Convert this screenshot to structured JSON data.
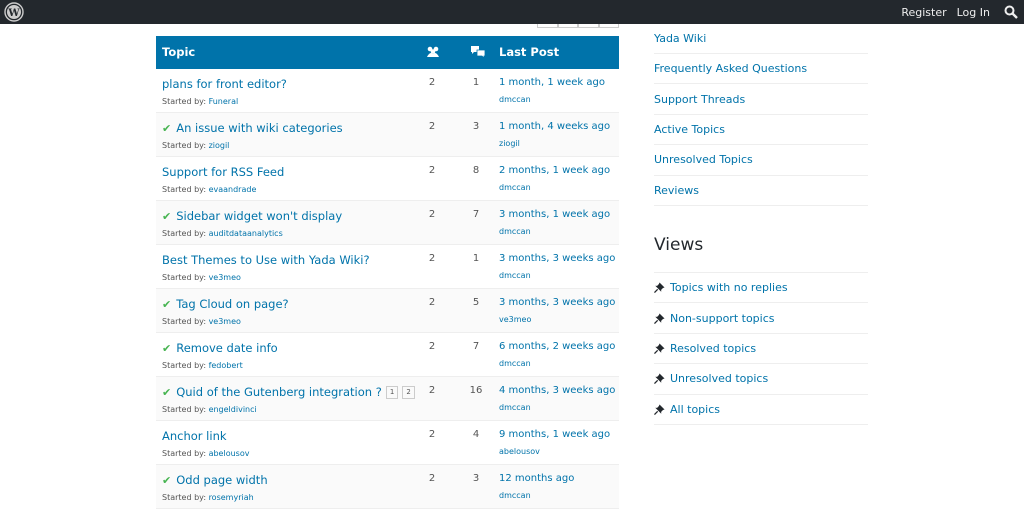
{
  "adminbar": {
    "register_label": "Register",
    "login_label": "Log In"
  },
  "table": {
    "col_topic": "Topic",
    "col_voices_icon": "voices-icon",
    "col_posts_icon": "replies-icon",
    "col_last_post": "Last Post",
    "started_by_label": "Started by:",
    "rows": [
      {
        "title": "plans for front editor?",
        "resolved": false,
        "author": "Funeral",
        "voices": "2",
        "posts": "1",
        "freshness": "1 month, 1 week ago",
        "last_author": "dmccan",
        "pages": []
      },
      {
        "title": "An issue with wiki categories",
        "resolved": true,
        "author": "ziogil",
        "voices": "2",
        "posts": "3",
        "freshness": "1 month, 4 weeks ago",
        "last_author": "ziogil",
        "pages": []
      },
      {
        "title": "Support for RSS Feed",
        "resolved": false,
        "author": "evaandrade",
        "voices": "2",
        "posts": "8",
        "freshness": "2 months, 1 week ago",
        "last_author": "dmccan",
        "pages": []
      },
      {
        "title": "Sidebar widget won't display",
        "resolved": true,
        "author": "auditdataanalytics",
        "voices": "2",
        "posts": "7",
        "freshness": "3 months, 1 week ago",
        "last_author": "dmccan",
        "pages": []
      },
      {
        "title": "Best Themes to Use with Yada Wiki?",
        "resolved": false,
        "author": "ve3meo",
        "voices": "2",
        "posts": "1",
        "freshness": "3 months, 3 weeks ago",
        "last_author": "dmccan",
        "pages": []
      },
      {
        "title": "Tag Cloud on page?",
        "resolved": true,
        "author": "ve3meo",
        "voices": "2",
        "posts": "5",
        "freshness": "3 months, 3 weeks ago",
        "last_author": "ve3meo",
        "pages": []
      },
      {
        "title": "Remove date info",
        "resolved": true,
        "author": "fedobert",
        "voices": "2",
        "posts": "7",
        "freshness": "6 months, 2 weeks ago",
        "last_author": "dmccan",
        "pages": []
      },
      {
        "title": "Quid of the Gutenberg integration ?",
        "resolved": true,
        "author": "engeldivinci",
        "voices": "2",
        "posts": "16",
        "freshness": "4 months, 3 weeks ago",
        "last_author": "dmccan",
        "pages": [
          "1",
          "2"
        ]
      },
      {
        "title": "Anchor link",
        "resolved": false,
        "author": "abelousov",
        "voices": "2",
        "posts": "4",
        "freshness": "9 months, 1 week ago",
        "last_author": "abelousov",
        "pages": []
      },
      {
        "title": "Odd page width",
        "resolved": true,
        "author": "rosemyriah",
        "voices": "2",
        "posts": "3",
        "freshness": "12 months ago",
        "last_author": "dmccan",
        "pages": []
      }
    ]
  },
  "sidebar": {
    "links": [
      "Yada Wiki",
      "Frequently Asked Questions",
      "Support Threads",
      "Active Topics",
      "Unresolved Topics",
      "Reviews"
    ],
    "views_title": "Views",
    "views": [
      "Topics with no replies",
      "Non-support topics",
      "Resolved topics",
      "Unresolved topics",
      "All topics"
    ]
  },
  "colors": {
    "accent": "#0073aa",
    "adminbar": "#23282d",
    "resolved": "#46b450"
  }
}
